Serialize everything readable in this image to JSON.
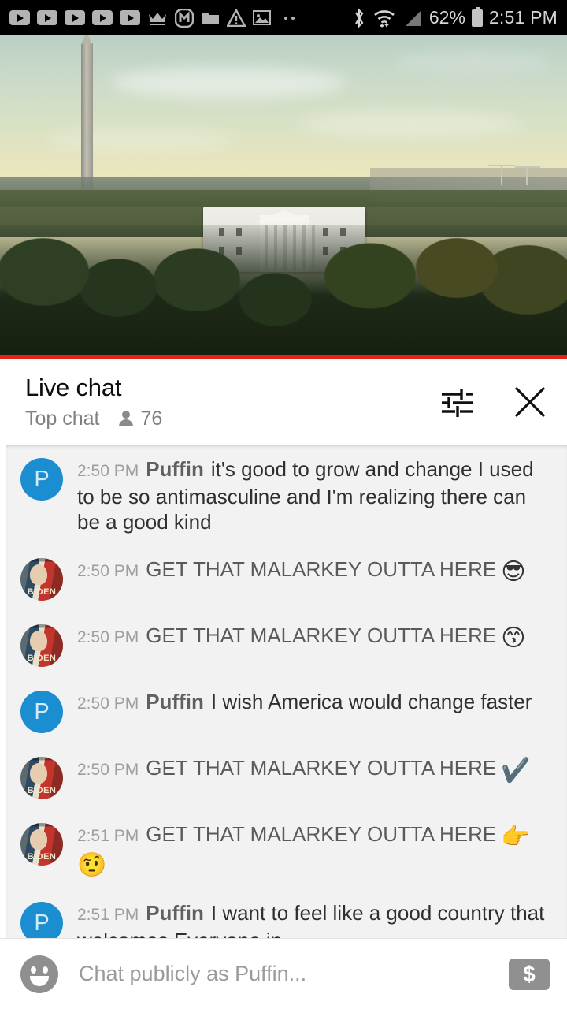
{
  "status_bar": {
    "left_icons": [
      "youtube-play-icon",
      "youtube-play-icon",
      "youtube-play-icon",
      "youtube-play-icon",
      "youtube-play-icon",
      "crown-icon",
      "m-circle-icon",
      "folder-icon",
      "warning-triangle-icon",
      "image-icon",
      "more-dots-icon"
    ],
    "bluetooth": "bluetooth-icon",
    "wifi": "wifi-icon",
    "signal": "cell-signal-icon",
    "battery_percent": "62%",
    "battery": "battery-icon",
    "clock": "2:51 PM"
  },
  "video": {
    "scene": "white-house-washington-monument-livestream",
    "progress_bar_color": "#e62117"
  },
  "chat_header": {
    "title": "Live chat",
    "subtitle": "Top chat",
    "viewer_count": "76",
    "viewer_icon": "person-icon",
    "settings_icon": "tune-sliders-icon",
    "close_icon": "close-x-icon"
  },
  "messages": [
    {
      "avatar_type": "letter",
      "avatar_letter": "P",
      "avatar_color": "#1b8ed1",
      "timestamp": "2:50 PM",
      "author": "Puffin",
      "text": "it's good to grow and change I used to be so antimasculine and I'm realizing there can be a good kind",
      "emoji": "",
      "shout": false
    },
    {
      "avatar_type": "image",
      "avatar_letter": "",
      "avatar_color": "",
      "timestamp": "2:50 PM",
      "author": "",
      "text": "GET THAT MALARKEY OUTTA HERE",
      "emoji": "😎",
      "shout": true
    },
    {
      "avatar_type": "image",
      "avatar_letter": "",
      "avatar_color": "",
      "timestamp": "2:50 PM",
      "author": "",
      "text": "GET THAT MALARKEY OUTTA HERE",
      "emoji": "😙",
      "shout": true
    },
    {
      "avatar_type": "letter",
      "avatar_letter": "P",
      "avatar_color": "#1b8ed1",
      "timestamp": "2:50 PM",
      "author": "Puffin",
      "text": "I wish America would change faster",
      "emoji": "",
      "shout": false
    },
    {
      "avatar_type": "image",
      "avatar_letter": "",
      "avatar_color": "",
      "timestamp": "2:50 PM",
      "author": "",
      "text": "GET THAT MALARKEY OUTTA HERE",
      "emoji": "✔️",
      "shout": true
    },
    {
      "avatar_type": "image",
      "avatar_letter": "",
      "avatar_color": "",
      "timestamp": "2:51 PM",
      "author": "",
      "text": "GET THAT MALARKEY OUTTA HERE",
      "emoji": "👉🤨",
      "shout": true
    },
    {
      "avatar_type": "letter",
      "avatar_letter": "P",
      "avatar_color": "#1b8ed1",
      "timestamp": "2:51 PM",
      "author": "Puffin",
      "text": "I want to feel like a good country that welcomes Everyone in",
      "emoji": "",
      "shout": false
    }
  ],
  "input_bar": {
    "emoji_icon": "emoji-smiley-icon",
    "placeholder": "Chat publicly as Puffin...",
    "value": "",
    "super_chat_icon": "dollar-money-icon",
    "super_chat_glyph": "$"
  }
}
